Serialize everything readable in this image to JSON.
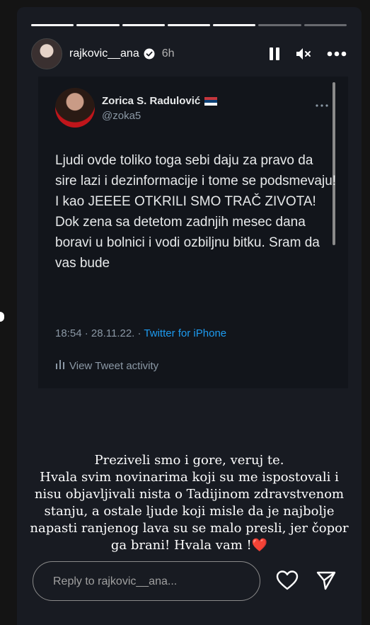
{
  "story": {
    "progress": {
      "segments_total": 7,
      "segments_done": 5
    }
  },
  "header": {
    "username": "rajkovic__ana",
    "verified_icon": "verified-badge-icon",
    "time_ago": "6h",
    "pause_icon": "pause-icon",
    "mute_icon": "speaker-muted-icon",
    "more_icon": "more-horizontal-icon"
  },
  "tweet": {
    "author_name": "Zorica S. Radulović",
    "flag_icon": "serbia-flag-icon",
    "handle": "@zoka5",
    "text": "Ljudi ovde toliko toga sebi daju za pravo da sire lazi i dezinformacije i tome se podsmevaju! I kao JEEEE OTKRILI SMO TRAČ ZIVOTA! Dok zena sa detetom zadnjih mesec dana boravi u bolnici i vodi ozbiljnu bitku. Sram da vas bude",
    "time": "18:54",
    "date": "28.11.22.",
    "separator": "·",
    "source": "Twitter for iPhone",
    "activity_label": "View Tweet activity",
    "activity_icon": "bar-chart-icon"
  },
  "caption": {
    "line1": "Preziveli smo i gore, veruj te.",
    "line2": "Hvala svim novinarima koji su me ispostovali i",
    "line3": "nisu objavljivali nista o Tadijinom zdravstvenom",
    "line4": "stanju, a ostale ljude koji misle da je najbolje",
    "line5": "napasti ranjenog lava su se malo presli, jer čopor",
    "line6": "ga brani! Hvala vam !",
    "heart_emoji": "❤️"
  },
  "footer": {
    "reply_placeholder": "Reply to rajkovic__ana...",
    "like_icon": "heart-icon",
    "share_icon": "send-icon"
  },
  "colors": {
    "link": "#1d9bf0",
    "background": "#181b22",
    "heart": "#e0242d"
  }
}
